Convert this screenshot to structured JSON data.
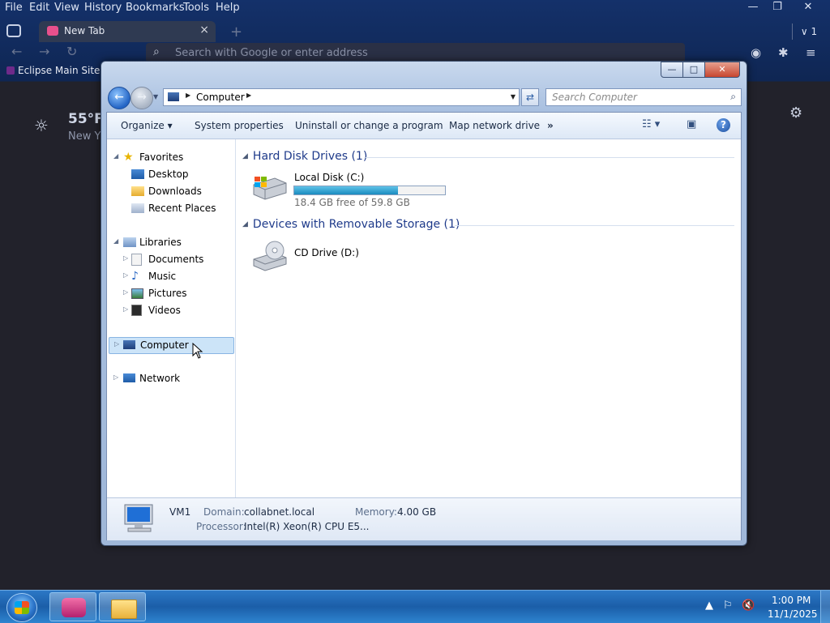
{
  "browser": {
    "menu": [
      {
        "label": "File"
      },
      {
        "label": "Edit"
      },
      {
        "label": "View"
      },
      {
        "label": "History"
      },
      {
        "label": "Bookmarks"
      },
      {
        "label": "Tools"
      },
      {
        "label": "Help"
      }
    ],
    "window_controls": {
      "minimize": "—",
      "restore": "❐",
      "close": "✕"
    },
    "tab": {
      "title": "New Tab"
    },
    "tab_count": "1",
    "url_placeholder": "Search with Google or enter address",
    "bookmark": "Eclipse Main Site",
    "weather": {
      "temp": "55°F",
      "city": "New Y"
    }
  },
  "explorer": {
    "window_controls": {
      "minimize": "—",
      "maximize": "□",
      "close": "✕"
    },
    "address": {
      "crumb": "Computer"
    },
    "search_placeholder": "Search Computer",
    "commands": {
      "organize": "Organize",
      "system_properties": "System properties",
      "uninstall": "Uninstall or change a program",
      "map_drive": "Map network drive",
      "more": "»"
    },
    "nav": {
      "favorites": "Favorites",
      "desktop": "Desktop",
      "downloads": "Downloads",
      "recent": "Recent Places",
      "libraries": "Libraries",
      "documents": "Documents",
      "music": "Music",
      "pictures": "Pictures",
      "videos": "Videos",
      "computer": "Computer",
      "network": "Network"
    },
    "groups": {
      "hard_disk": "Hard Disk Drives (1)",
      "removable": "Devices with Removable Storage (1)"
    },
    "drives": {
      "local": {
        "name": "Local Disk (C:)",
        "space": "18.4 GB free of 59.8 GB",
        "used_fraction": 0.69
      },
      "cd": {
        "name": "CD Drive (D:)"
      }
    },
    "details": {
      "name": "VM1",
      "domain_label": "Domain:",
      "domain_value": "collabnet.local",
      "memory_label": "Memory:",
      "memory_value": "4.00 GB",
      "processor_label": "Processor:",
      "processor_value": "Intel(R) Xeon(R) CPU E5..."
    }
  },
  "taskbar": {
    "time": "1:00 PM",
    "date": "11/1/2025"
  },
  "colors": {
    "accent": "#1e3a8a",
    "selection": "#cce4f8",
    "taskbar": "#1b5ea8"
  }
}
